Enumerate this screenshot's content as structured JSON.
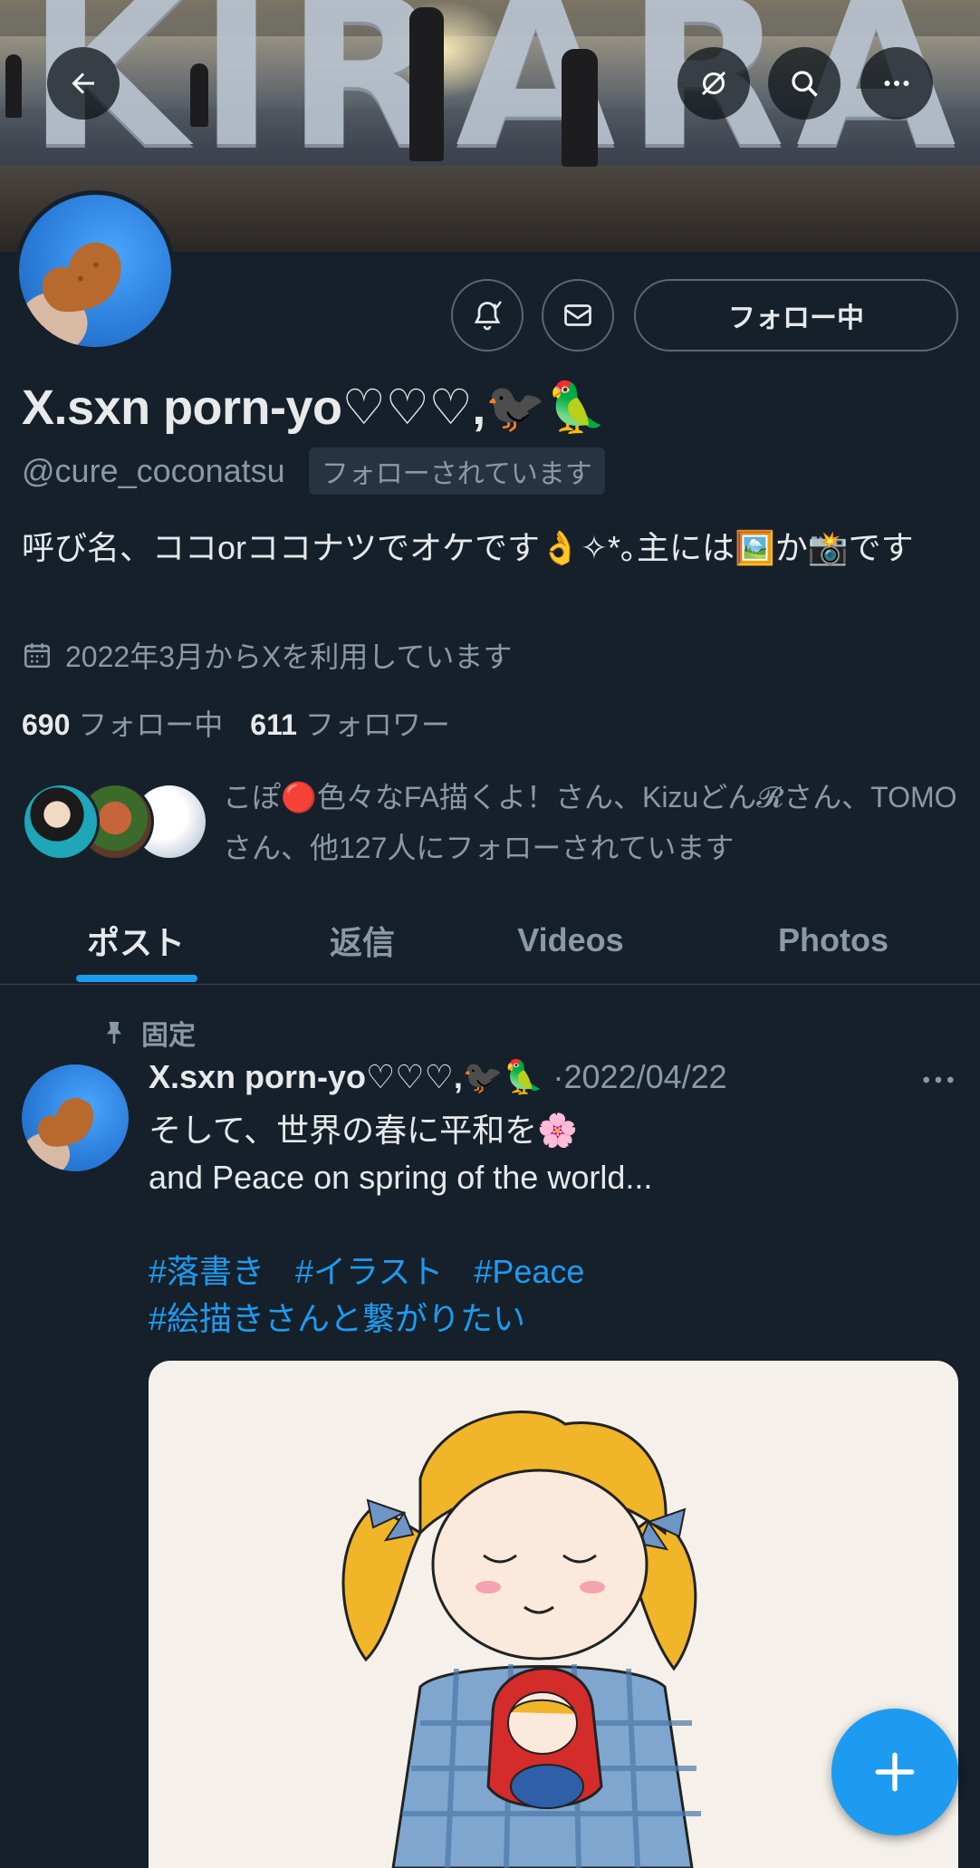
{
  "banner": {
    "text": "KIRARA"
  },
  "header": {
    "back_icon": "arrow-left-icon",
    "translate_icon": "eye-slash-icon",
    "search_icon": "search-icon",
    "more_icon": "more-horizontal-icon"
  },
  "profile": {
    "name": "X.sxn porn-yo♡♡♡,🐦‍⬛🦜",
    "handle": "@cure_coconatsu",
    "follows_you": "フォローされています",
    "follow_button": "フォロー中",
    "bio": "呼び名、ココorココナツでオケです👌✧*｡主には🖼️か📸です",
    "joined": "2022年3月からXを利用しています",
    "following_count": "690",
    "following_label": "フォロー中",
    "followers_count": "611",
    "followers_label": "フォロワー",
    "mutuals_text": "こぽ🔴色々なFA描くよ！さん、Kizuどん𝓡さん、TOMOさん、他127人にフォローされています"
  },
  "tabs": [
    {
      "label": "ポスト",
      "active": true
    },
    {
      "label": "返信",
      "active": false
    },
    {
      "label": "Videos",
      "active": false
    },
    {
      "label": "Photos",
      "active": false
    }
  ],
  "post": {
    "pinned_label": "固定",
    "author": "X.sxn porn-yo♡♡♡,🐦‍⬛🦜",
    "date": "·2022/04/22",
    "line1": "そして、世界の春に平和を🌸",
    "line2": "and Peace on spring of the world...",
    "hashtags": [
      "#落書き",
      "#イラスト",
      "#Peace",
      "#絵描きさんと繋がりたい"
    ]
  },
  "fab": {
    "icon": "plus-icon"
  },
  "colors": {
    "background": "#15202b",
    "accent": "#1d9bf0",
    "muted": "#8b98a5"
  }
}
